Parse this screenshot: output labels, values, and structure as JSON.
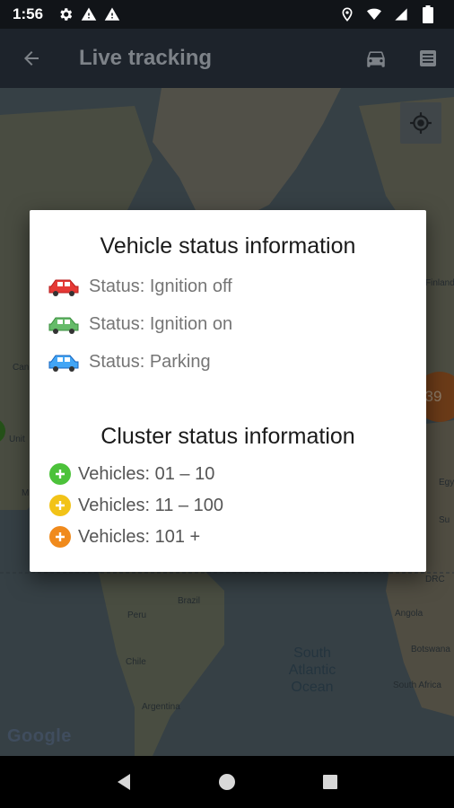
{
  "status_bar": {
    "time": "1:56",
    "left_icons": [
      "gear-icon",
      "warning-icon",
      "warning-icon"
    ],
    "right_icons": [
      "location-pin-icon",
      "wifi-icon",
      "signal-icon",
      "battery-icon"
    ]
  },
  "app_bar": {
    "title": "Live tracking",
    "back_icon": "arrow-left-icon",
    "actions": [
      "car-icon",
      "list-icon"
    ]
  },
  "map": {
    "labels": {
      "finland": "Finland",
      "canada": "Can",
      "united": "Unit",
      "mexico": "M",
      "egypt": "Egy",
      "sudan": "Su",
      "drc": "DRC",
      "angola": "Angola",
      "botswana": "Botswana",
      "south_africa": "South Africa",
      "brazil": "Brazil",
      "peru": "Peru",
      "chile": "Chile",
      "argentina": "Argentina",
      "ocean": "South Atlantic Ocean"
    },
    "cluster_right_label": "39",
    "google_logo": "Google",
    "locate_icon": "my-location-icon"
  },
  "dialog": {
    "vehicle_title": "Vehicle status information",
    "vehicle_items": [
      {
        "label": "Status: Ignition off",
        "color": "#e53935"
      },
      {
        "label": "Status: Ignition on",
        "color": "#4caf50"
      },
      {
        "label": "Status: Parking",
        "color": "#2196f3"
      }
    ],
    "cluster_title": "Cluster status information",
    "cluster_items": [
      {
        "label": "Vehicles: 01 – 10",
        "color": "#4cc23a"
      },
      {
        "label": "Vehicles: 11 – 100",
        "color": "#f2c318"
      },
      {
        "label": "Vehicles: 101 +",
        "color": "#f08a1c"
      }
    ]
  },
  "nav_bar": {
    "icons": [
      "back-triangle-icon",
      "home-circle-icon",
      "recents-square-icon"
    ]
  }
}
